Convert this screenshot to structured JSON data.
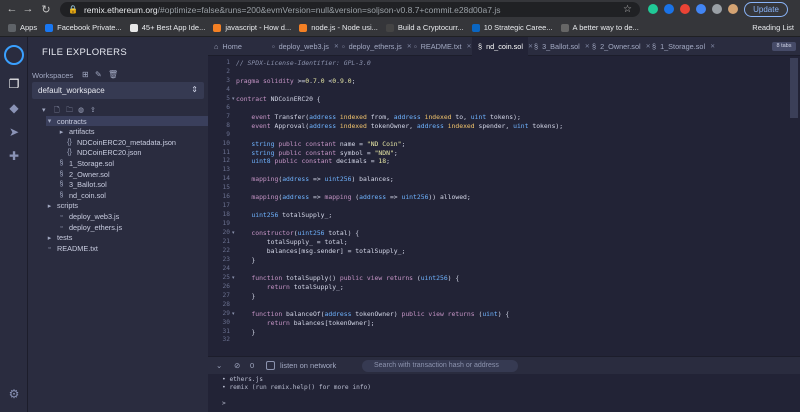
{
  "browser": {
    "url_host": "remix.ethereum.org",
    "url_path": "/#optimize=false&runs=200&evmVersion=null&version=soljson-v0.8.7+commit.e28d00a7.js",
    "update_label": "Update",
    "bookmarks": [
      {
        "label": "Apps",
        "color": "#5f6368"
      },
      {
        "label": "Facebook Private...",
        "color": "#1877f2"
      },
      {
        "label": "45+ Best App Ide...",
        "color": "#e8e8e8"
      },
      {
        "label": "javascript - How d...",
        "color": "#f48024"
      },
      {
        "label": "node.js - Node usi...",
        "color": "#f48024"
      },
      {
        "label": "Build a Cryptocurr...",
        "color": "#444444"
      },
      {
        "label": "10 Strategic Caree...",
        "color": "#0a66c2"
      },
      {
        "label": "A better way to de...",
        "color": "#666666"
      }
    ],
    "reading_list": "Reading List"
  },
  "explorer": {
    "title": "FILE EXPLORERS",
    "workspaces_label": "Workspaces",
    "workspace": "default_workspace",
    "tree": [
      {
        "label": "contracts",
        "icon": "folder-open-icon"
      },
      {
        "label": "artifacts",
        "icon": "folder-icon"
      },
      {
        "label": "NDCoinERC20_metadata.json",
        "icon": "braces-icon"
      },
      {
        "label": "NDCoinERC20.json",
        "icon": "braces-icon"
      },
      {
        "label": "1_Storage.sol",
        "icon": "sol-icon"
      },
      {
        "label": "2_Owner.sol",
        "icon": "sol-icon"
      },
      {
        "label": "3_Ballot.sol",
        "icon": "sol-icon"
      },
      {
        "label": "nd_coin.sol",
        "icon": "sol-icon"
      },
      {
        "label": "scripts",
        "icon": "folder-icon"
      },
      {
        "label": "deploy_web3.js",
        "icon": "file-icon"
      },
      {
        "label": "deploy_ethers.js",
        "icon": "file-icon"
      },
      {
        "label": "tests",
        "icon": "folder-icon"
      },
      {
        "label": "README.txt",
        "icon": "file-icon"
      }
    ]
  },
  "tabs": [
    {
      "label": "Home"
    },
    {
      "label": "deploy_web3.js"
    },
    {
      "label": "deploy_ethers.js"
    },
    {
      "label": "README.txt"
    },
    {
      "label": "nd_coin.sol"
    },
    {
      "label": "3_Ballot.sol"
    },
    {
      "label": "2_Owner.sol"
    },
    {
      "label": "1_Storage.sol"
    }
  ],
  "zoom_label": "8 tabs",
  "code_lines": [
    {
      "n": "1",
      "text": "// SPDX-License-Identifier: GPL-3.0",
      "fold": ""
    },
    {
      "n": "2",
      "text": "",
      "fold": ""
    },
    {
      "n": "3",
      "text": "pragma solidity >=0.7.0 <0.9.0;",
      "fold": ""
    },
    {
      "n": "4",
      "text": "",
      "fold": ""
    },
    {
      "n": "5",
      "text": "contract NDCoinERC20 {",
      "fold": "▾"
    },
    {
      "n": "6",
      "text": "",
      "fold": ""
    },
    {
      "n": "7",
      "text": "    event Transfer(address indexed from, address indexed to, uint tokens);",
      "fold": ""
    },
    {
      "n": "8",
      "text": "    event Approval(address indexed tokenOwner, address indexed spender, uint tokens);",
      "fold": ""
    },
    {
      "n": "9",
      "text": "",
      "fold": ""
    },
    {
      "n": "10",
      "text": "    string public constant name = \"ND Coin\";",
      "fold": ""
    },
    {
      "n": "11",
      "text": "    string public constant symbol = \"NDN\";",
      "fold": ""
    },
    {
      "n": "12",
      "text": "    uint8 public constant decimals = 18;",
      "fold": ""
    },
    {
      "n": "13",
      "text": "",
      "fold": ""
    },
    {
      "n": "14",
      "text": "    mapping(address => uint256) balances;",
      "fold": ""
    },
    {
      "n": "15",
      "text": "",
      "fold": ""
    },
    {
      "n": "16",
      "text": "    mapping(address => mapping (address => uint256)) allowed;",
      "fold": ""
    },
    {
      "n": "17",
      "text": "",
      "fold": ""
    },
    {
      "n": "18",
      "text": "    uint256 totalSupply_;",
      "fold": ""
    },
    {
      "n": "19",
      "text": "",
      "fold": ""
    },
    {
      "n": "20",
      "text": "    constructor(uint256 total) {",
      "fold": "▾"
    },
    {
      "n": "21",
      "text": "        totalSupply_ = total;",
      "fold": ""
    },
    {
      "n": "22",
      "text": "        balances[msg.sender] = totalSupply_;",
      "fold": ""
    },
    {
      "n": "23",
      "text": "    }",
      "fold": ""
    },
    {
      "n": "24",
      "text": "",
      "fold": ""
    },
    {
      "n": "25",
      "text": "    function totalSupply() public view returns (uint256) {",
      "fold": "▾"
    },
    {
      "n": "26",
      "text": "        return totalSupply_;",
      "fold": ""
    },
    {
      "n": "27",
      "text": "    }",
      "fold": ""
    },
    {
      "n": "28",
      "text": "",
      "fold": ""
    },
    {
      "n": "29",
      "text": "    function balanceOf(address tokenOwner) public view returns (uint) {",
      "fold": "▾"
    },
    {
      "n": "30",
      "text": "        return balances[tokenOwner];",
      "fold": ""
    },
    {
      "n": "31",
      "text": "    }",
      "fold": ""
    },
    {
      "n": "32",
      "text": "",
      "fold": ""
    }
  ],
  "terminal": {
    "count": "0",
    "listen_label": "listen on network",
    "search_placeholder": "Search with transaction hash or address",
    "lines": [
      "• ethers.js",
      "• remix (run remix.help() for more info)",
      "",
      ">"
    ]
  }
}
